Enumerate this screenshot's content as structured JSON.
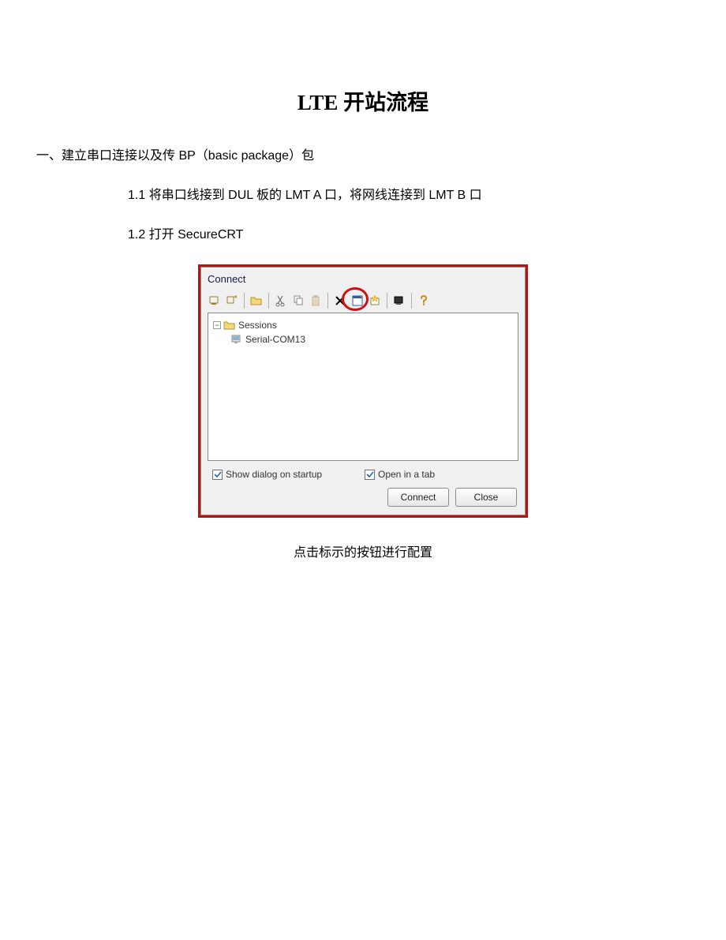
{
  "title": "LTE 开站流程",
  "section1": {
    "heading": "一、建立串口连接以及传 BP（basic package）包",
    "item1": "1.1 将串口线接到 DUL 板的 LMT A 口，将网线连接到 LMT B 口",
    "item2": "1.2 打开 SecureCRT"
  },
  "dialog": {
    "title": "Connect",
    "tree": {
      "root": "Sessions",
      "child": "Serial-COM13"
    },
    "checkbox1": "Show dialog on startup",
    "checkbox2": "Open in a tab",
    "btn_connect": "Connect",
    "btn_close": "Close"
  },
  "caption": "点击标示的按钮进行配置",
  "icons": {
    "minus": "−"
  }
}
